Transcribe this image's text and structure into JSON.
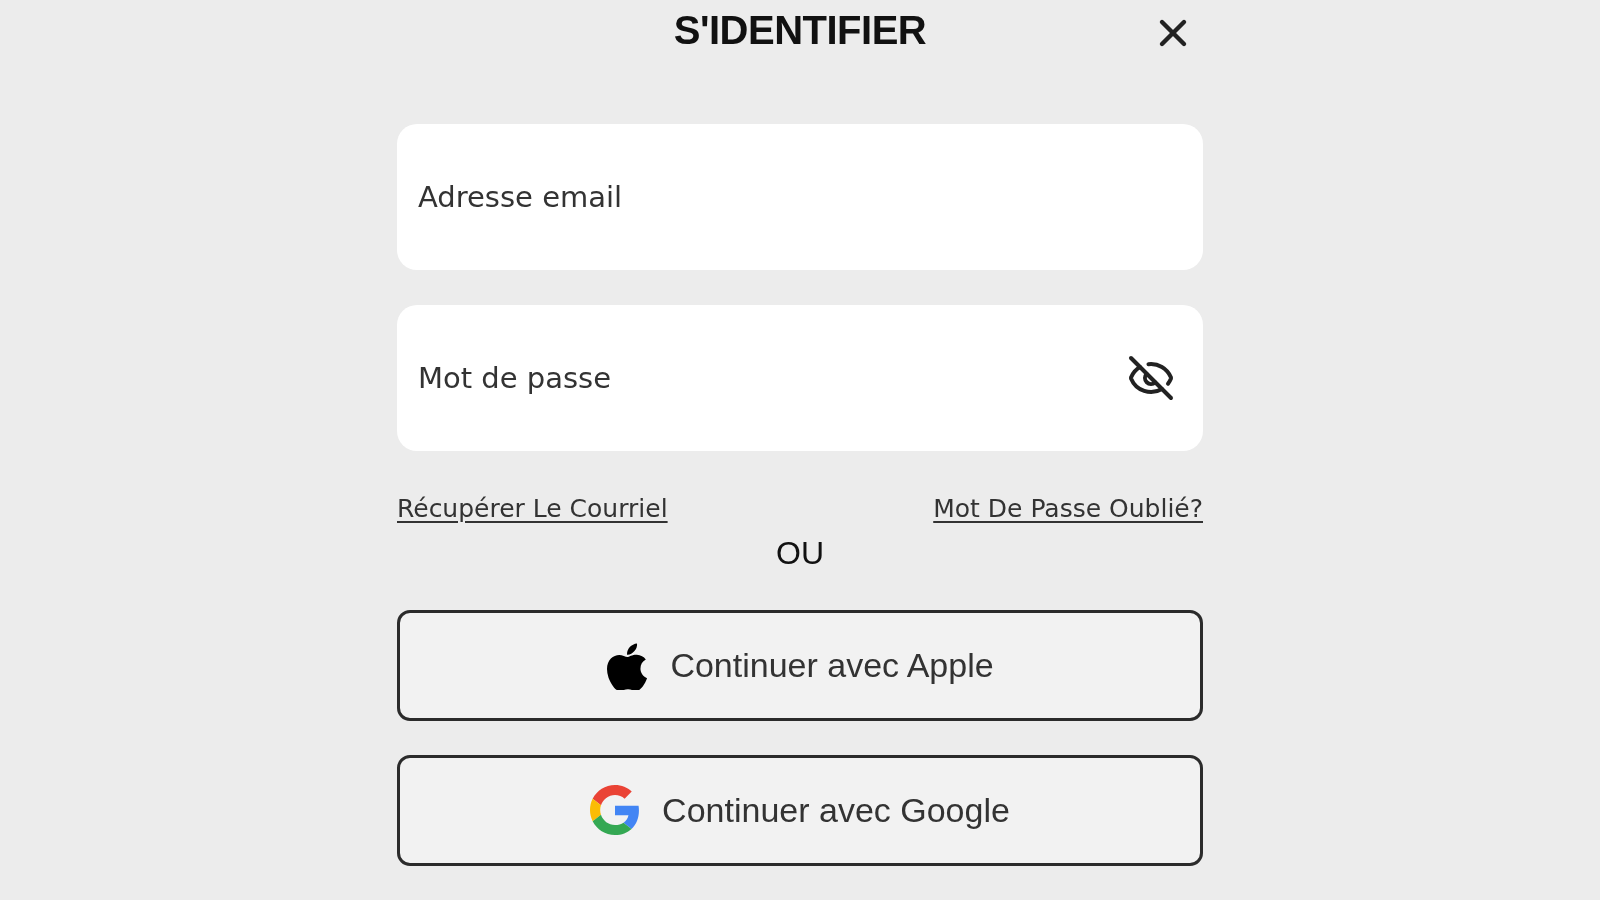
{
  "dialog": {
    "title": "S'IDENTIFIER"
  },
  "fields": [
    {
      "kind": "email",
      "placeholder": "Adresse email"
    },
    {
      "kind": "password",
      "placeholder": "Mot de passe"
    }
  ],
  "links": [
    "Récupérer Le Courriel",
    "Mot De Passe Oublié?"
  ],
  "separator": "OU",
  "buttons": [
    {
      "kind": "apple",
      "label": "Continuer avec Apple"
    },
    {
      "kind": "google",
      "label": "Continuer avec Google"
    }
  ]
}
